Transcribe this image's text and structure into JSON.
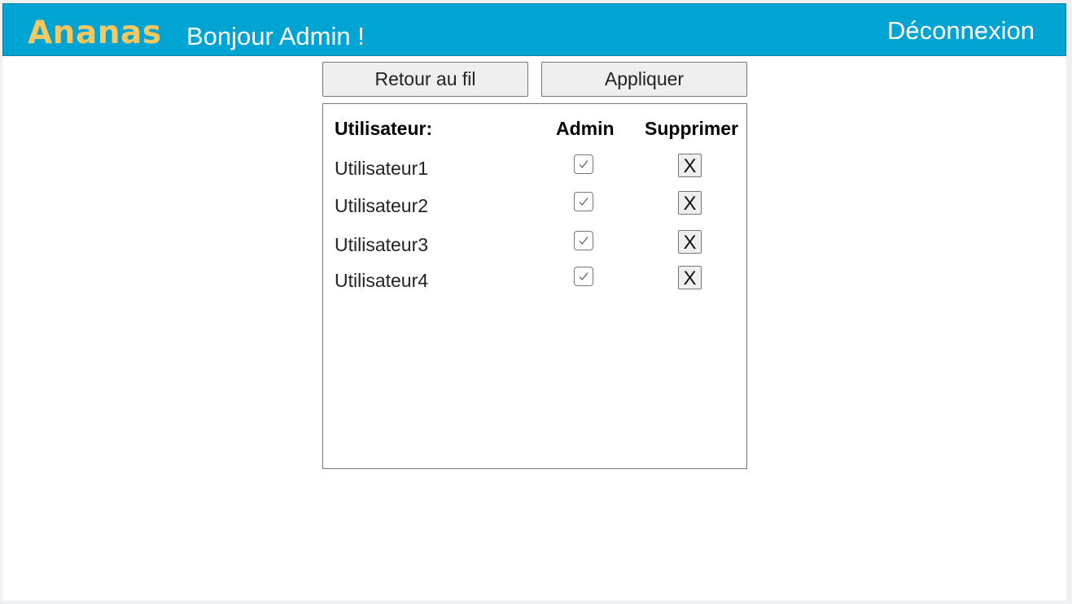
{
  "header": {
    "logo": "Ananas",
    "greeting": "Bonjour Admin !",
    "logout_label": "Déconnexion"
  },
  "actions": {
    "back_label": "Retour au fil",
    "apply_label": "Appliquer"
  },
  "table": {
    "headers": {
      "user": "Utilisateur:",
      "admin": "Admin",
      "delete": "Supprimer"
    },
    "rows": [
      {
        "name": "Utilisateur1",
        "admin": true,
        "delete_label": "X"
      },
      {
        "name": "Utilisateur2",
        "admin": true,
        "delete_label": "X"
      },
      {
        "name": "Utilisateur3",
        "admin": true,
        "delete_label": "X"
      },
      {
        "name": "Utilisateur4",
        "admin": true,
        "delete_label": "X"
      }
    ]
  },
  "colors": {
    "header_bg": "#00a4d3",
    "logo": "#f8c75f",
    "header_text": "#ffffff"
  },
  "icons": {
    "checkmark": "checkmark-icon"
  }
}
